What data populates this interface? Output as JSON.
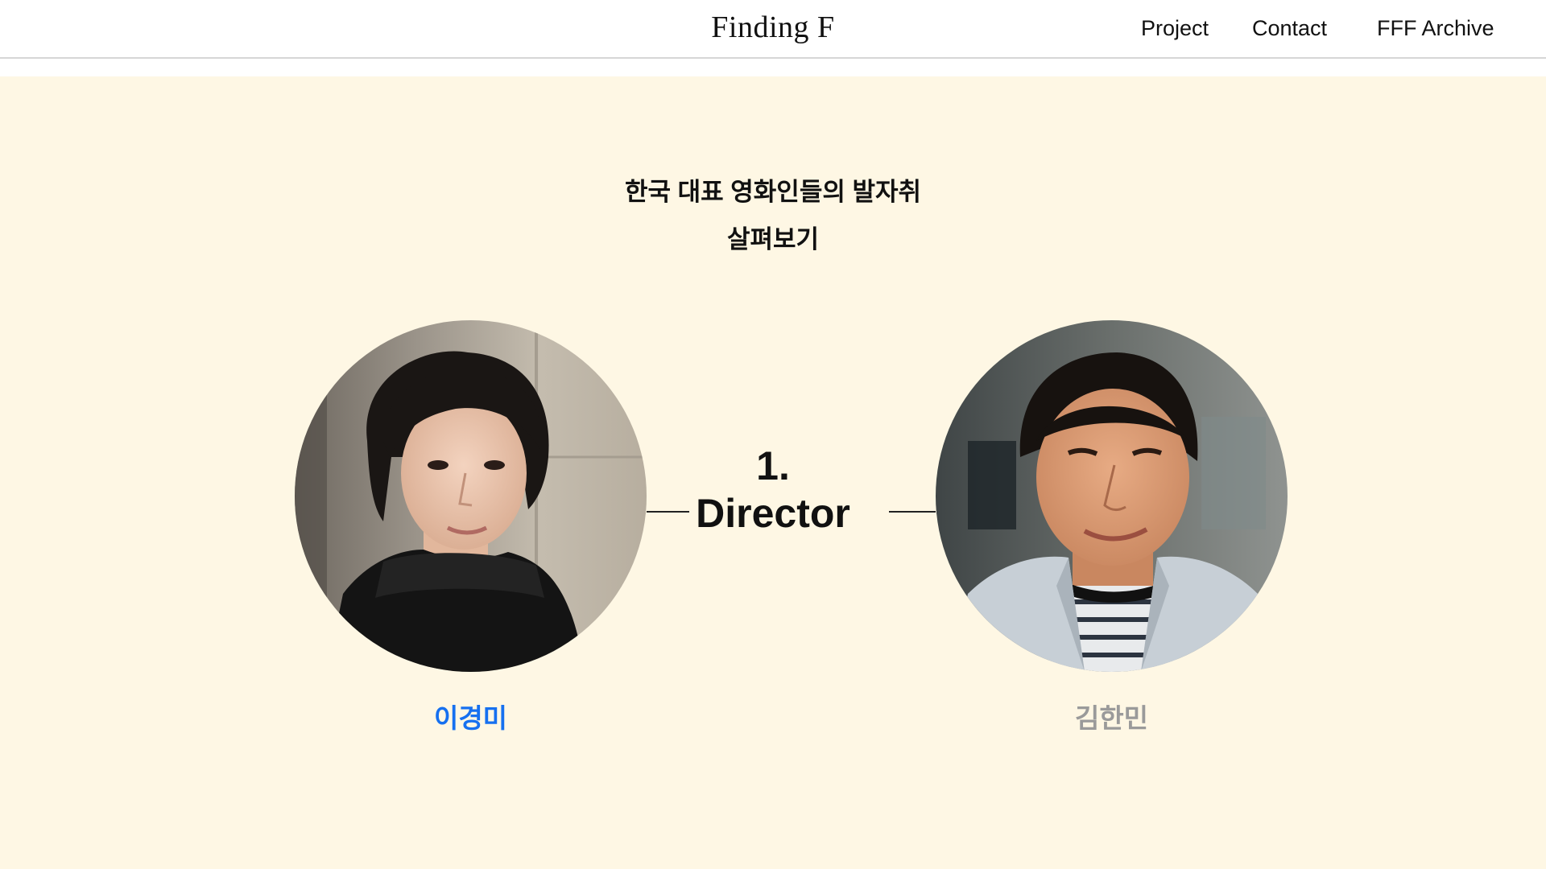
{
  "header": {
    "logo": "Finding F",
    "nav": [
      {
        "label": "Project"
      },
      {
        "label": "Contact"
      },
      {
        "label": "FFF Archive"
      }
    ]
  },
  "main": {
    "headline_line1": "한국 대표 영화인들의 발자취",
    "headline_line2": "살펴보기",
    "role_number": "1.",
    "role_title": "Director",
    "people": [
      {
        "name": "이경미",
        "active": true
      },
      {
        "name": "김한민",
        "active": false
      }
    ]
  },
  "colors": {
    "background": "#fef7e4",
    "active_name": "#1670f0",
    "inactive_name": "#9a9a9a",
    "text": "#111111"
  }
}
